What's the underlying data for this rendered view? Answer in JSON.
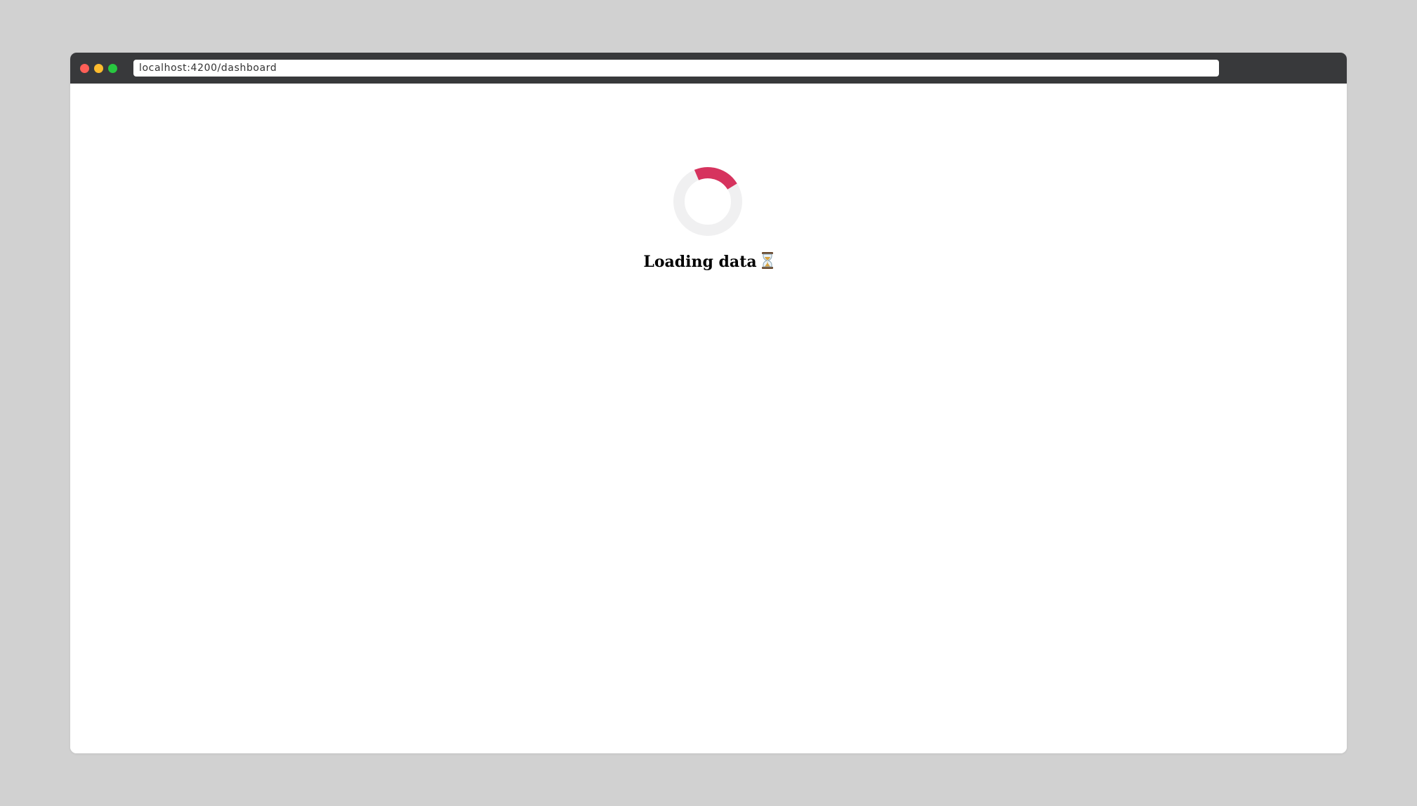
{
  "browser": {
    "url": "localhost:4200/dashboard"
  },
  "page": {
    "loading_text": "Loading data",
    "icons": {
      "spinner": "spinner-icon",
      "hourglass": "hourglass-icon"
    }
  },
  "colors": {
    "spinner_accent": "#d6335e",
    "spinner_track": "#f0f0f1",
    "titlebar": "#38393b",
    "background": "#d1d1d1"
  }
}
